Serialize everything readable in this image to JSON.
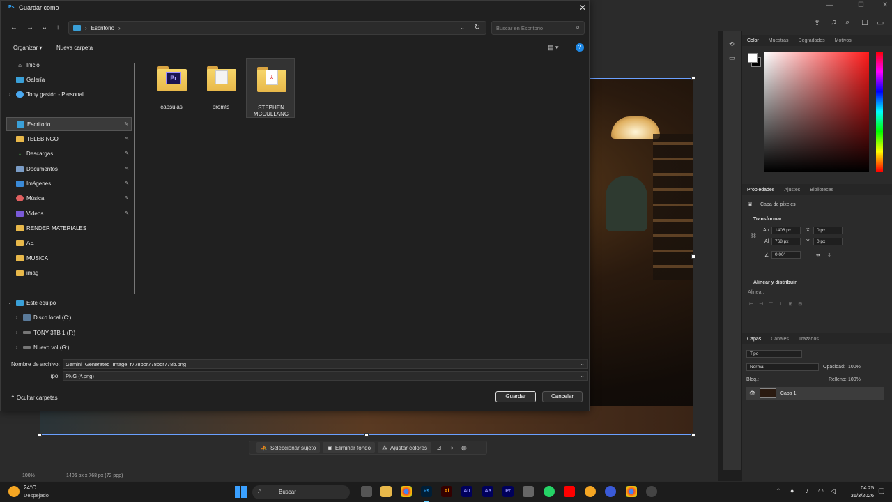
{
  "dialog": {
    "app_badge": "Ps",
    "title": "Guardar como",
    "close": "✕",
    "nav": {
      "back": "←",
      "forward": "→",
      "recent": "⌄",
      "up": "↑"
    },
    "address": {
      "location": "Escritorio",
      "refresh": "↻"
    },
    "search_placeholder": "Buscar en Escritorio",
    "toolbar": {
      "organize": "Organizar ▾",
      "new_folder": "Nueva carpeta",
      "help": "?"
    },
    "sidebar": {
      "items": [
        {
          "label": "Inicio"
        },
        {
          "label": "Galería"
        },
        {
          "label": "Tony gastón - Personal"
        },
        {
          "label": "Escritorio"
        },
        {
          "label": "TELEBINGO"
        },
        {
          "label": "Descargas"
        },
        {
          "label": "Documentos"
        },
        {
          "label": "Imágenes"
        },
        {
          "label": "Música"
        },
        {
          "label": "Videos"
        },
        {
          "label": "RENDER MATERIALES"
        },
        {
          "label": "AE"
        },
        {
          "label": "MUSICA"
        },
        {
          "label": "imag"
        },
        {
          "label": "Este equipo"
        },
        {
          "label": "Disco local (C:)"
        },
        {
          "label": "TONY 3TB 1 (F:)"
        },
        {
          "label": "Nuevo vol (G:)"
        }
      ]
    },
    "files": [
      {
        "name": "capsulas",
        "badge": "Pr"
      },
      {
        "name": "promts"
      },
      {
        "name": "STEPHEN MCCULLANG"
      }
    ],
    "filename_label": "Nombre de archivo:",
    "filename_value": "Gemini_Generated_Image_r778bor778bor778b.png",
    "type_label": "Tipo:",
    "type_value": "PNG (*.png)",
    "hide_folders": "⌃  Ocultar carpetas",
    "save": "Guardar",
    "cancel": "Cancelar"
  },
  "photoshop": {
    "context_bar": {
      "select_subject": "Seleccionar sujeto",
      "remove_bg": "Eliminar fondo",
      "adjust_colors": "Ajustar colores",
      "more": "⋯"
    },
    "status": {
      "zoom": "100%",
      "doc_info": "1406 px x 768 px (72 ppp)"
    },
    "color_tabs": [
      "Color",
      "Muestras",
      "Degradados",
      "Motivos"
    ],
    "props_tabs": [
      "Propiedades",
      "Ajustes",
      "Bibliotecas"
    ],
    "props": {
      "layer_type": "Capa de píxeles",
      "transform": "Transformar",
      "w_label": "An",
      "w_value": "1406 px",
      "x_label": "X",
      "x_value": "0 px",
      "h_label": "Al",
      "h_value": "768 px",
      "y_label": "Y",
      "y_value": "0 px",
      "angle_value": "0,00°",
      "align": "Alinear y distribuir",
      "align_sub": "Alinear:"
    },
    "layers_tabs": [
      "Capas",
      "Canales",
      "Trazados"
    ],
    "layers": {
      "kind": "Tipo",
      "blend": "Normal",
      "opacity_label": "Opacidad:",
      "opacity_value": "100%",
      "lock_label": "Bloq.:",
      "fill_label": "Relleno:",
      "fill_value": "100%",
      "layer_name": "Capa 1"
    }
  },
  "taskbar": {
    "weather_temp": "24°C",
    "weather_desc": "Despejado",
    "search": "Buscar",
    "time": "04:25",
    "date": "31/3/2026",
    "apps": [
      "Ps",
      "Ai",
      "Au",
      "Ae",
      "Pr"
    ]
  },
  "colors": {
    "accent": "#1e88e5",
    "folder": "#e8b84a",
    "ps_blue": "#31a8ff"
  }
}
